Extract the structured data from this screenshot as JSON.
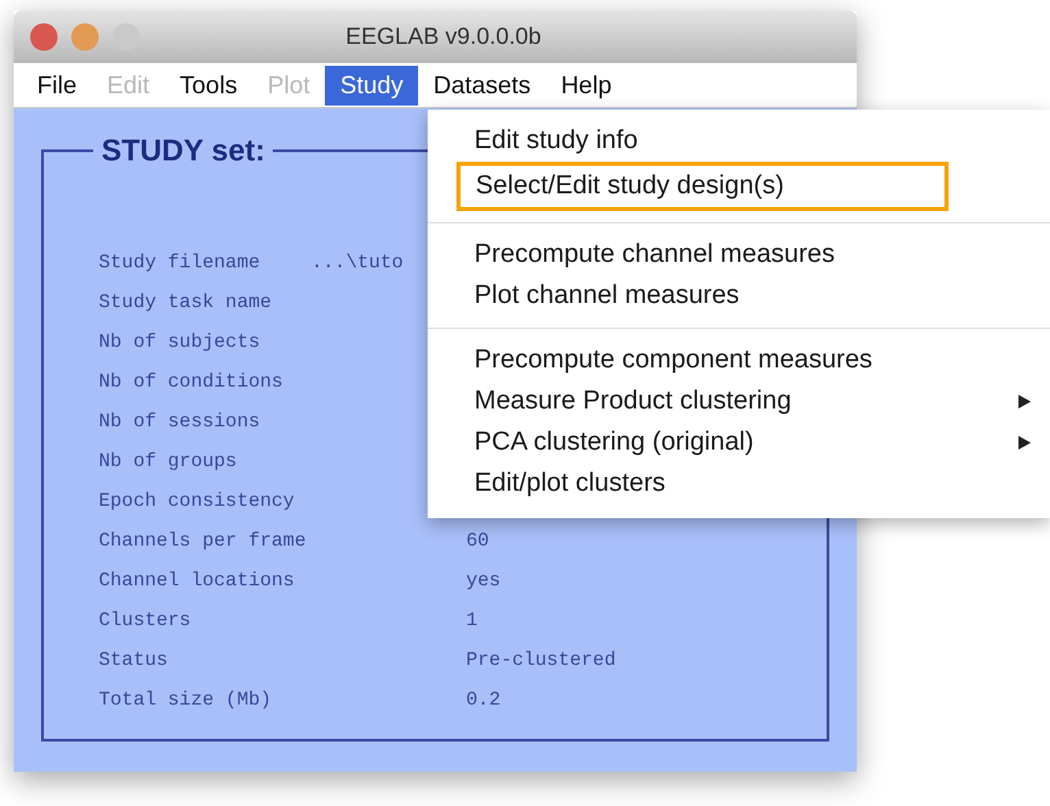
{
  "window": {
    "title": "EEGLAB v9.0.0.0b"
  },
  "menu_bar": [
    {
      "label": "File",
      "disabled": false,
      "selected": false
    },
    {
      "label": "Edit",
      "disabled": true,
      "selected": false
    },
    {
      "label": "Tools",
      "disabled": false,
      "selected": false
    },
    {
      "label": "Plot",
      "disabled": true,
      "selected": false
    },
    {
      "label": "Study",
      "disabled": false,
      "selected": true
    },
    {
      "label": "Datasets",
      "disabled": false,
      "selected": false
    },
    {
      "label": "Help",
      "disabled": false,
      "selected": false
    }
  ],
  "panel": {
    "title": "STUDY set:",
    "rows": [
      {
        "label": "Study filename",
        "value": "...\\tuto",
        "kind": "path"
      },
      {
        "label": "Study task name"
      },
      {
        "label": "Nb of subjects"
      },
      {
        "label": "Nb of conditions"
      },
      {
        "label": "Nb of sessions"
      },
      {
        "label": "Nb of groups"
      },
      {
        "label": "Epoch consistency"
      },
      {
        "label": "Channels per frame",
        "value": "60"
      },
      {
        "label": "Channel locations",
        "value": "yes"
      },
      {
        "label": "Clusters",
        "value": "1"
      },
      {
        "label": "Status",
        "value": "Pre-clustered"
      },
      {
        "label": "Total size (Mb)",
        "value": "0.2"
      }
    ]
  },
  "study_menu": {
    "groups": [
      [
        {
          "label": "Edit study info",
          "submenu": false,
          "outlined": false
        },
        {
          "label": "Select/Edit study design(s)",
          "submenu": false,
          "outlined": true
        }
      ],
      [
        {
          "label": "Precompute channel measures",
          "submenu": false,
          "outlined": false
        },
        {
          "label": "Plot channel measures",
          "submenu": false,
          "outlined": false
        }
      ],
      [
        {
          "label": "Precompute component measures",
          "submenu": false,
          "outlined": false
        },
        {
          "label": "Measure Product clustering",
          "submenu": true,
          "outlined": false
        },
        {
          "label": "PCA clustering (original)",
          "submenu": true,
          "outlined": false
        },
        {
          "label": "Edit/plot clusters",
          "submenu": false,
          "outlined": false
        }
      ]
    ]
  }
}
